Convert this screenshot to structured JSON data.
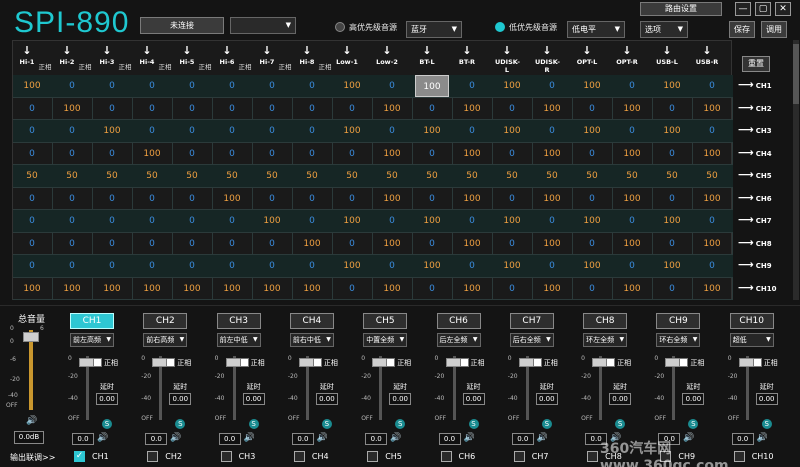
{
  "app": {
    "title": "SPI-890"
  },
  "topbar": {
    "connection_button": "未连接",
    "device_select": "",
    "high_priority_label": "高优先级音源",
    "high_priority_value": "蓝牙",
    "low_priority_label": "低优先级音源",
    "low_priority_value": "低电平",
    "route_settings": "路由设置",
    "options": "选项",
    "save": "保存",
    "recall": "调用",
    "win_min": "—",
    "win_max": "▢",
    "win_close": "✕"
  },
  "matrix": {
    "reset_label": "重置",
    "inputs": [
      "Hi-1",
      "Hi-2",
      "Hi-3",
      "Hi-4",
      "Hi-5",
      "Hi-6",
      "Hi-7",
      "Hi-8",
      "Low-1",
      "Low-2",
      "BT-L",
      "BT-R",
      "UDISK-L",
      "UDISK-R",
      "OPT-L",
      "OPT-R",
      "USB-L",
      "USB-R"
    ],
    "phase_label": "正相",
    "rows": [
      {
        "out": "CH1",
        "vals": [
          100,
          0,
          0,
          0,
          0,
          0,
          0,
          0,
          100,
          0,
          100,
          0,
          100,
          0,
          100,
          0,
          100,
          0
        ]
      },
      {
        "out": "CH2",
        "vals": [
          0,
          100,
          0,
          0,
          0,
          0,
          0,
          0,
          0,
          100,
          0,
          100,
          0,
          100,
          0,
          100,
          0,
          100
        ]
      },
      {
        "out": "CH3",
        "vals": [
          0,
          0,
          100,
          0,
          0,
          0,
          0,
          0,
          100,
          0,
          100,
          0,
          100,
          0,
          100,
          0,
          100,
          0
        ]
      },
      {
        "out": "CH4",
        "vals": [
          0,
          0,
          0,
          100,
          0,
          0,
          0,
          0,
          0,
          100,
          0,
          100,
          0,
          100,
          0,
          100,
          0,
          100
        ]
      },
      {
        "out": "CH5",
        "vals": [
          50,
          50,
          50,
          50,
          50,
          50,
          50,
          50,
          50,
          50,
          50,
          50,
          50,
          50,
          50,
          50,
          50,
          50
        ]
      },
      {
        "out": "CH6",
        "vals": [
          0,
          0,
          0,
          0,
          0,
          100,
          0,
          0,
          0,
          100,
          0,
          100,
          0,
          100,
          0,
          100,
          0,
          100
        ]
      },
      {
        "out": "CH7",
        "vals": [
          0,
          0,
          0,
          0,
          0,
          0,
          100,
          0,
          100,
          0,
          100,
          0,
          100,
          0,
          100,
          0,
          100,
          0
        ]
      },
      {
        "out": "CH8",
        "vals": [
          0,
          0,
          0,
          0,
          0,
          0,
          0,
          100,
          0,
          100,
          0,
          100,
          0,
          100,
          0,
          100,
          0,
          100
        ]
      },
      {
        "out": "CH9",
        "vals": [
          0,
          0,
          0,
          0,
          0,
          0,
          0,
          0,
          100,
          0,
          100,
          0,
          100,
          0,
          100,
          0,
          100,
          0
        ]
      },
      {
        "out": "CH10",
        "vals": [
          100,
          100,
          100,
          100,
          100,
          100,
          100,
          100,
          0,
          100,
          0,
          100,
          0,
          100,
          0,
          100,
          0,
          100
        ]
      }
    ],
    "selected_cell": "100"
  },
  "master": {
    "label": "总音量",
    "scale": [
      "0",
      "6",
      "0",
      "-6",
      "-20",
      "-40",
      "OFF"
    ],
    "value": "0.0dB",
    "level_db": 0.0
  },
  "channels": [
    {
      "name": "CH1",
      "position": "前左高频",
      "phase": "正相",
      "delay_label": "延时",
      "delay": "0.00",
      "vol": "0.0",
      "linked": true,
      "active": true
    },
    {
      "name": "CH2",
      "position": "前右高频",
      "phase": "正相",
      "delay_label": "延时",
      "delay": "0.00",
      "vol": "0.0",
      "linked": false,
      "active": false
    },
    {
      "name": "CH3",
      "position": "前左中低",
      "phase": "正相",
      "delay_label": "延时",
      "delay": "0.00",
      "vol": "0.0",
      "linked": false,
      "active": false
    },
    {
      "name": "CH4",
      "position": "前右中低",
      "phase": "正相",
      "delay_label": "延时",
      "delay": "0.00",
      "vol": "0.0",
      "linked": false,
      "active": false
    },
    {
      "name": "CH5",
      "position": "中置全频",
      "phase": "正相",
      "delay_label": "延时",
      "delay": "0.00",
      "vol": "0.0",
      "linked": false,
      "active": false
    },
    {
      "name": "CH6",
      "position": "后左全频",
      "phase": "正相",
      "delay_label": "延时",
      "delay": "0.00",
      "vol": "0.0",
      "linked": false,
      "active": false
    },
    {
      "name": "CH7",
      "position": "后右全频",
      "phase": "正相",
      "delay_label": "延时",
      "delay": "0.00",
      "vol": "0.0",
      "linked": false,
      "active": false
    },
    {
      "name": "CH8",
      "position": "环左全频",
      "phase": "正相",
      "delay_label": "延时",
      "delay": "0.00",
      "vol": "0.0",
      "linked": false,
      "active": false
    },
    {
      "name": "CH9",
      "position": "环右全频",
      "phase": "正相",
      "delay_label": "延时",
      "delay": "0.00",
      "vol": "0.0",
      "linked": false,
      "active": false
    },
    {
      "name": "CH10",
      "position": "超低",
      "phase": "正相",
      "delay_label": "延时",
      "delay": "0.00",
      "vol": "0.0",
      "linked": false,
      "active": false
    }
  ],
  "fader_scale": [
    "0",
    "-20",
    "-40",
    "OFF"
  ],
  "output_link_label": "输出联调>>",
  "watermark": "360汽车网 www.360qc.com",
  "colors": {
    "accent": "#1fc8d0",
    "val_100": "#f0a040",
    "val_50": "#f0a040",
    "val_0": "#3a8de0"
  }
}
